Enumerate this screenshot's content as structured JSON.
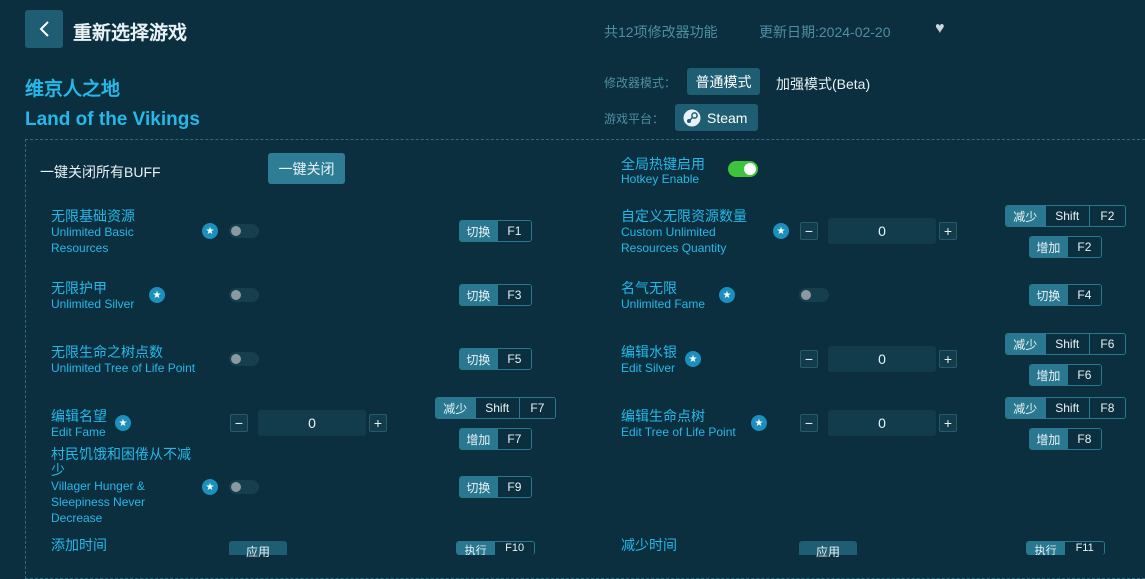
{
  "header": {
    "title": "重新选择游戏",
    "feature_count": "共12项修改器功能",
    "update_date": "更新日期:2024-02-20"
  },
  "game": {
    "name_cn": "维京人之地",
    "name_en": "Land of the Vikings"
  },
  "mode": {
    "label": "修改器模式：",
    "normal": "普通模式",
    "enhanced": "加强模式(Beta)"
  },
  "platform": {
    "label": "游戏平台：",
    "name": "Steam"
  },
  "controls": {
    "close_all_label": "一键关闭所有BUFF",
    "close_all_button": "一键关闭",
    "hotkey_cn": "全局热键启用",
    "hotkey_en": "Hotkey Enable"
  },
  "keys": {
    "toggle": "切换",
    "decrease": "减少",
    "increase": "增加",
    "execute": "执行",
    "apply": "应用",
    "shift": "Shift"
  },
  "options": {
    "o1": {
      "cn": "无限基础资源",
      "en1": "Unlimited Basic",
      "en2": "Resources",
      "key": "F1"
    },
    "o2": {
      "cn": "无限护甲",
      "en": "Unlimited Silver",
      "key": "F3"
    },
    "o3": {
      "cn": "无限生命之树点数",
      "en": "Unlimited Tree of Life Point",
      "key": "F5"
    },
    "o4": {
      "cn": "编辑名望",
      "en": "Edit Fame",
      "value": "0",
      "key_dec": "F7",
      "key_inc": "F7"
    },
    "o5": {
      "cn1": "村民饥饿和困倦从不减",
      "cn2": "少",
      "en1": "Villager Hunger &",
      "en2": "Sleepiness Never",
      "en3": "Decrease",
      "key": "F9"
    },
    "o6": {
      "cn": "添加时间",
      "key": "F10"
    },
    "o7": {
      "cn": "自定义无限资源数量",
      "en1": "Custom Unlimited",
      "en2": "Resources Quantity",
      "value": "0",
      "key_dec": "F2",
      "key_inc": "F2"
    },
    "o8": {
      "cn": "名气无限",
      "en": "Unlimited Fame",
      "key": "F4"
    },
    "o9": {
      "cn": "编辑水银",
      "en": "Edit Silver",
      "value": "0",
      "key_dec": "F6",
      "key_inc": "F6"
    },
    "o10": {
      "cn": "编辑生命点树",
      "en": "Edit Tree of Life Point",
      "value": "0",
      "key_dec": "F8",
      "key_inc": "F8"
    },
    "o11": {
      "cn": "减少时间",
      "key": "F11"
    }
  },
  "icons": {
    "back": "chevron-left-icon",
    "heart": "heart-icon",
    "star": "star-icon",
    "steam": "steam-icon"
  },
  "colors": {
    "accent": "#25b8e8",
    "button": "#1f5d72",
    "toggle_on": "#3cc43c",
    "background": "#0b2f3e"
  }
}
